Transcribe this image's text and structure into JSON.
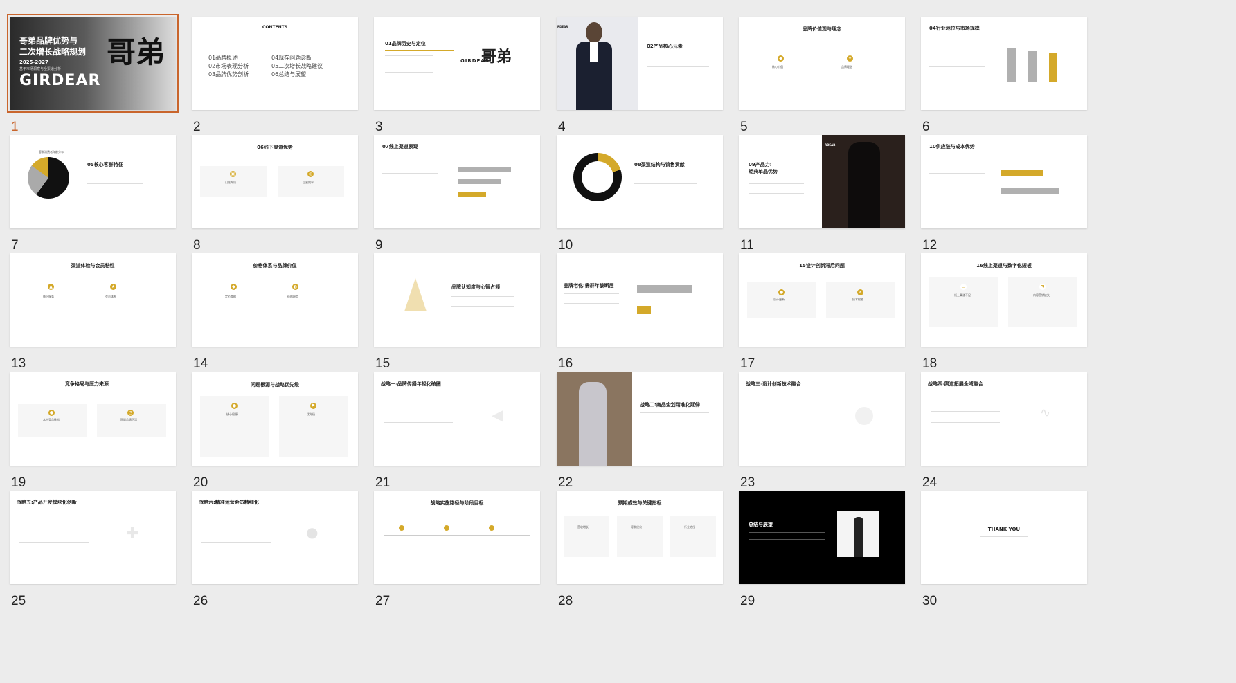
{
  "app": {
    "view": "slide-sorter",
    "selected_slide": 1,
    "accent_color": "#c9652c",
    "brand_gold": "#d4a92a"
  },
  "slides": [
    {
      "num": "1",
      "title_line1": "哥弟品牌优势与",
      "title_line2": "二次增长战略规划",
      "years": "2025-2027",
      "subtitle": "基于市场洞察与全渠道分析",
      "brand": "GIRDEAR",
      "logo_glyphs": "哥弟"
    },
    {
      "num": "2",
      "title": "CONTENTS",
      "items": [
        "01品牌概述",
        "02市场表现分析",
        "03品牌优势剖析",
        "04现存问题诊断",
        "05二次增长战略建议",
        "06总结与展望"
      ]
    },
    {
      "num": "3",
      "title": "01品牌历史与定位",
      "logo_text": "GIRDEAR",
      "logo_glyphs": "哥弟"
    },
    {
      "num": "4",
      "title": "02产品核心元素",
      "brand_fragment": "RDEAR"
    },
    {
      "num": "5",
      "title": "品牌价值观与理念",
      "card1": "核心价值",
      "card2": "品牌理念"
    },
    {
      "num": "6",
      "title": "04行业地位与市场规模"
    },
    {
      "num": "7",
      "title": "05核心客群特征",
      "chart_title": "客群消费者年龄分布"
    },
    {
      "num": "8",
      "title": "06线下渠道优势",
      "card1": "门店布局",
      "card2": "运营效率"
    },
    {
      "num": "9",
      "title": "07线上渠道表现"
    },
    {
      "num": "10",
      "title": "08渠道结构与销售贡献"
    },
    {
      "num": "11",
      "title_line1": "09产品力:",
      "title_line2": "经典单品优势",
      "brand_fragment": "RDEAR"
    },
    {
      "num": "12",
      "title": "10供应链与成本优势"
    },
    {
      "num": "13",
      "title": "渠道体验与会员粘性",
      "card1": "线下服务",
      "card2": "会员体系"
    },
    {
      "num": "14",
      "title": "价格体系与品牌价值",
      "card1": "定价策略",
      "card2": "价格稳定"
    },
    {
      "num": "15",
      "title": "品牌认知度与心智占领"
    },
    {
      "num": "16",
      "title": "品牌老化:需群年龄断层"
    },
    {
      "num": "17",
      "title": "15设计创新滞后问题",
      "card1": "设计更新",
      "card2": "技术赋能"
    },
    {
      "num": "18",
      "title": "16线上渠道与数字化短板",
      "card1": "线上渠道不足",
      "card2": "内容营销缺失"
    },
    {
      "num": "19",
      "title": "竞争格局与压力来源",
      "card1": "本土竞品挑战",
      "card2": "国际品牌下沉"
    },
    {
      "num": "20",
      "title": "问题根源与战略优先级",
      "card1": "核心根源",
      "card2": "优先级"
    },
    {
      "num": "21",
      "title": "战略一:品牌传播年轻化破圈"
    },
    {
      "num": "22",
      "title": "战略二:商品企划精准化延伸"
    },
    {
      "num": "23",
      "title": "战略三:设计创新技术融合"
    },
    {
      "num": "24",
      "title": "战略四:渠道拓展全域融合"
    },
    {
      "num": "25",
      "title": "战略五:产品开发模块化创新"
    },
    {
      "num": "26",
      "title": "战略六:精准运营会员精细化"
    },
    {
      "num": "27",
      "title": "战略实施路径与阶段目标"
    },
    {
      "num": "28",
      "title": "预期成效与关键指标",
      "card1": "营收增长",
      "card2": "客群优化",
      "card3": "行业地位"
    },
    {
      "num": "29",
      "title": "总结与展望"
    },
    {
      "num": "30",
      "title": "THANK YOU"
    }
  ]
}
